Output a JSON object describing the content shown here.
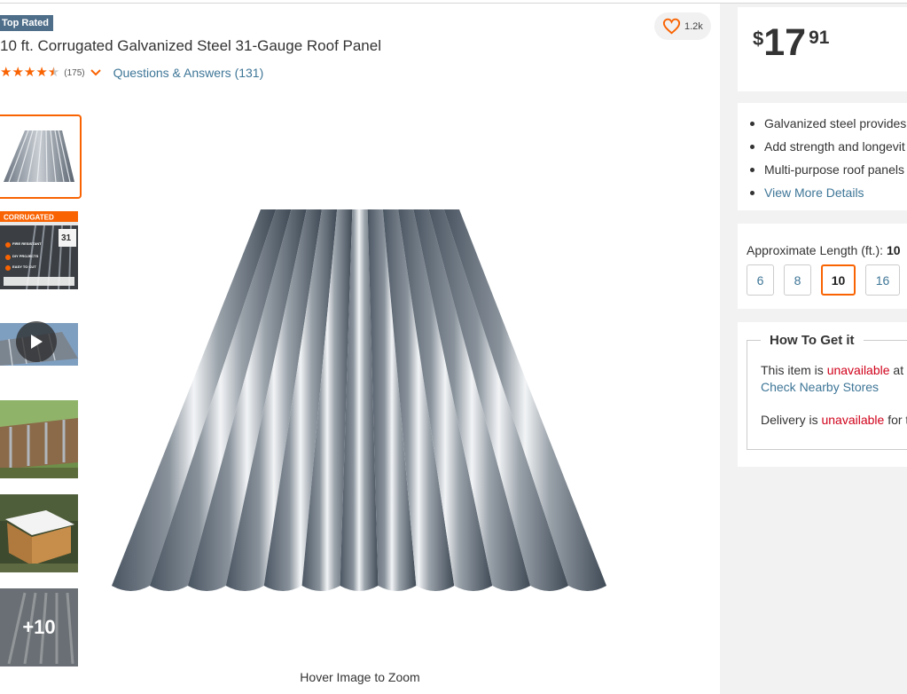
{
  "badge": "Top Rated",
  "favorites": {
    "count": "1.2k",
    "icon": "heart-icon"
  },
  "product": {
    "title": "10 ft. Corrugated Galvanized Steel 31-Gauge Roof Panel",
    "rating": 4.5,
    "review_count": "(175)",
    "qa_link": "Questions & Answers (131)"
  },
  "thumbnails": {
    "package_banner": "CORRUGATED",
    "package_gauge": "31",
    "package_features": [
      "FIRE RESISTANT",
      "DIY PROJECTS",
      "EASY TO CUT"
    ],
    "more_label": "+10"
  },
  "gallery": {
    "hover_hint": "Hover Image to Zoom"
  },
  "price": {
    "currency": "$",
    "dollars": "17",
    "cents": "91"
  },
  "highlights": [
    "Galvanized steel provides",
    "Add strength and longevit",
    "Multi-purpose roof panels"
  ],
  "view_more": "View More Details",
  "length": {
    "label": "Approximate Length (ft.):",
    "selected": "10",
    "options": [
      "6",
      "8",
      "10",
      "16"
    ]
  },
  "how_to_get": {
    "title": "How To Get it",
    "store_prefix": "This item is",
    "store_status": "unavailable",
    "store_suffix": "at",
    "check_stores": "Check Nearby Stores",
    "delivery_prefix": "Delivery is",
    "delivery_status": "unavailable",
    "delivery_suffix": "for t"
  },
  "colors": {
    "accent": "#f96302",
    "link": "#3e7697",
    "error": "#d0021b",
    "badge": "#4f6e8a"
  }
}
